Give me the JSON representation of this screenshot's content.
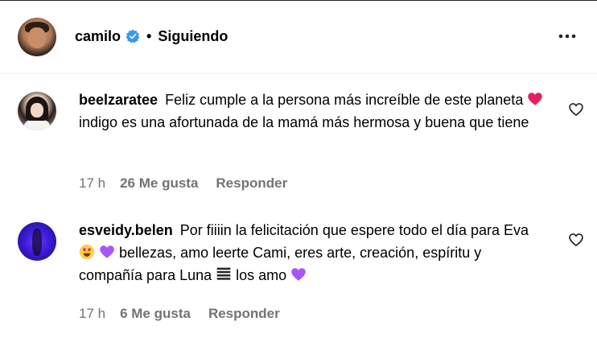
{
  "post_header": {
    "username": "camilo",
    "separator": "•",
    "follow_status": "Siguiendo"
  },
  "comments": [
    {
      "username": "beelzaratee",
      "text_before_emoji": "Feliz cumple a la persona más increíble de este planeta",
      "emoji_1": "red-heart",
      "text_after_emoji": "indigo es una afortunada de la mamá más hermosa y buena que tiene",
      "time": "17 h",
      "likes": "26 Me gusta",
      "reply_label": "Responder"
    },
    {
      "username": "esveidy.belen",
      "text_part_1": "Por fiiiin la felicitación que espere todo el día para Eva",
      "text_part_2": "bellezas, amo leerte Cami, eres arte, creación, espíritu y compañía para Luna",
      "text_part_3": "los amo",
      "time": "17 h",
      "likes": "6 Me gusta",
      "reply_label": "Responder"
    }
  ],
  "colors": {
    "verified": "#3897f0",
    "meta_text": "#737373",
    "heart_emoji": "#e0245e",
    "purple_heart": "#a855f7"
  },
  "icons": [
    "verified-badge-icon",
    "more-options-icon",
    "like-heart-icon"
  ]
}
